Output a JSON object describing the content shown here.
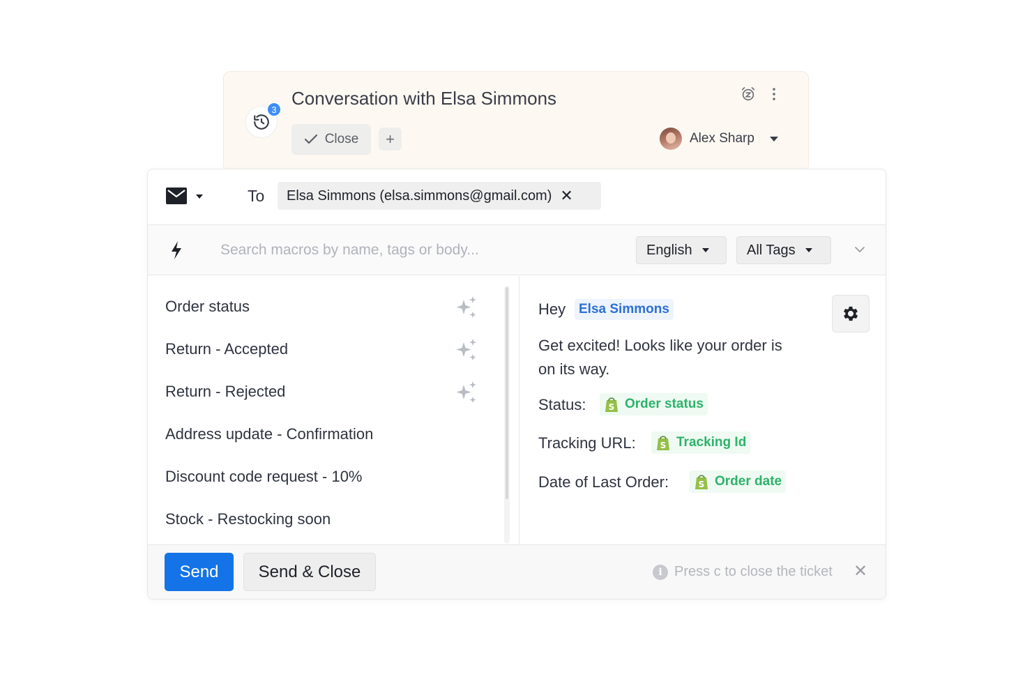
{
  "header": {
    "title": "Conversation with Elsa Simmons",
    "history_count": "3",
    "close_label": "Close",
    "add_label": "+",
    "assignee_name": "Alex Sharp"
  },
  "composer": {
    "to_label": "To",
    "recipient": "Elsa Simmons (elsa.simmons@gmail.com)",
    "recipient_remove": "✕"
  },
  "macros": {
    "search_placeholder": "Search macros by name, tags or body...",
    "language": "English",
    "tags_filter": "All Tags",
    "items": [
      {
        "label": "Order status",
        "ai": true
      },
      {
        "label": "Return - Accepted",
        "ai": true
      },
      {
        "label": "Return - Rejected",
        "ai": true
      },
      {
        "label": "Address update - Confirmation",
        "ai": false
      },
      {
        "label": "Discount code request - 10%",
        "ai": false
      },
      {
        "label": "Stock - Restocking soon",
        "ai": false
      }
    ]
  },
  "preview": {
    "greeting": "Hey",
    "customer_var": "Elsa Simmons",
    "body_line1": "Get excited! Looks like your order is",
    "body_line2": "on its way.",
    "status_label": "Status:",
    "status_var": "Order status",
    "tracking_label": "Tracking URL:",
    "tracking_var": "Tracking Id",
    "last_order_label": "Date of Last Order:",
    "last_order_var": "Order date"
  },
  "footer": {
    "send_label": "Send",
    "send_close_label": "Send & Close",
    "hint": "Press c to close the ticket",
    "hint_dismiss": "✕"
  },
  "colors": {
    "primary": "#1473e6",
    "variable_blue": "#2c6fd6",
    "shopify_green": "#2fb26a",
    "badge": "#3e8ef7"
  }
}
